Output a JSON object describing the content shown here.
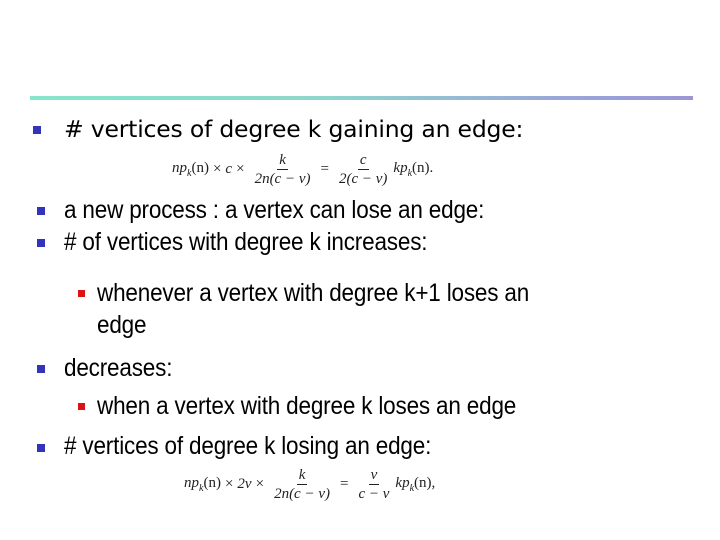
{
  "slide": {
    "accent_rule_colors": [
      "#86e6cc",
      "#9b96d8"
    ],
    "bullet_color": "#3333bb",
    "sub_bullet_color": "#dd1111",
    "bullets": [
      {
        "text": "# vertices of degree k gaining an edge:"
      },
      {
        "text": "a new process : a vertex can lose an edge:"
      },
      {
        "text": "# of vertices with degree k increases:"
      },
      {
        "text": "decreases:"
      },
      {
        "text": "# vertices of degree k losing an edge:"
      }
    ],
    "sub_bullets": [
      {
        "lines": [
          "whenever a vertex with degree k+1 loses an",
          "edge"
        ]
      },
      {
        "lines": [
          "when a vertex with degree k loses an  edge"
        ]
      }
    ],
    "formula_gain": {
      "lhs_prefix_n": "np",
      "lhs_sub": "k",
      "lhs_arg": "(n)",
      "times1": "×",
      "factor": "c",
      "times2": "×",
      "frac1_num": "k",
      "frac1_den": "2n(c − v)",
      "equals": "=",
      "frac2_num": "c",
      "frac2_den": "2(c − v)",
      "rhs_prefix": "kp",
      "rhs_sub": "k",
      "rhs_arg": "(n).",
      "full_text": "np_k(n) × c × k / 2n(c − v) = c / 2(c − v) kp_k(n)."
    },
    "formula_lose": {
      "lhs_prefix_n": "np",
      "lhs_sub": "k",
      "lhs_arg": "(n)",
      "times1": "×",
      "factor": "2v",
      "times2": "×",
      "frac1_num": "k",
      "frac1_den": "2n(c − v)",
      "equals": "=",
      "frac2_num": "v",
      "frac2_den": "c − v",
      "rhs_prefix": "kp",
      "rhs_sub": "k",
      "rhs_arg": "(n),",
      "full_text": "np_k(n) × 2v × k / 2n(c − v) = v / (c − v) kp_k(n),"
    }
  }
}
